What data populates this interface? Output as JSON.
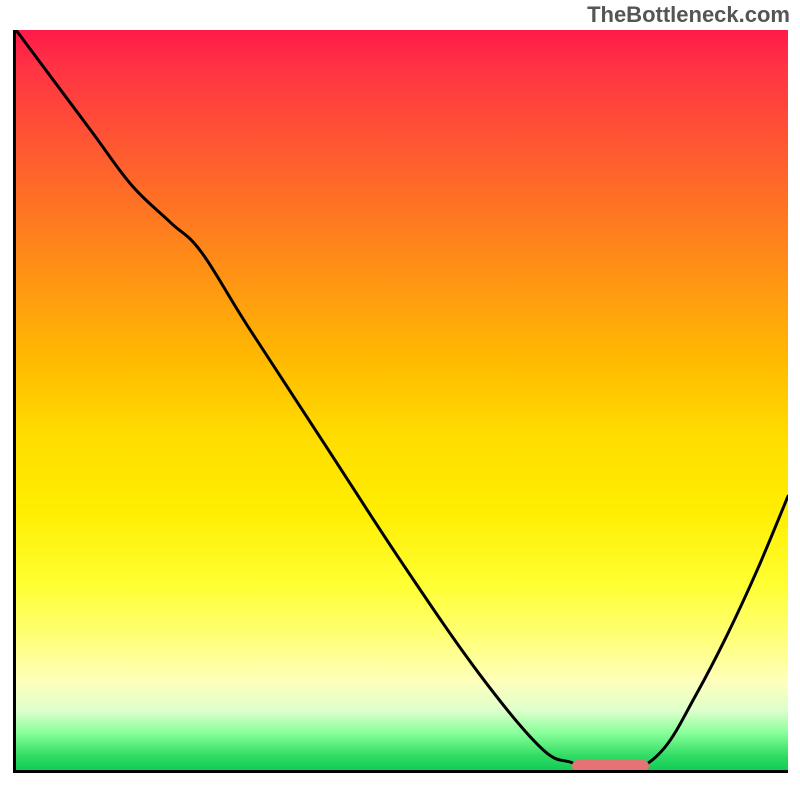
{
  "watermark": "TheBottleneck.com",
  "chart_data": {
    "type": "line",
    "title": "",
    "xlabel": "",
    "ylabel": "",
    "xlim": [
      0,
      100
    ],
    "ylim": [
      0,
      100
    ],
    "grid": false,
    "series": [
      {
        "name": "curve",
        "x": [
          0,
          5,
          10,
          15,
          20,
          24,
          30,
          40,
          50,
          60,
          68,
          72,
          76,
          80,
          84,
          88,
          92,
          96,
          100
        ],
        "y": [
          100,
          93,
          86,
          79,
          74,
          70,
          60,
          44,
          28,
          13,
          3,
          1,
          0,
          0,
          3,
          10,
          18,
          27,
          37
        ]
      }
    ],
    "marker": {
      "x_start": 72,
      "x_end": 82,
      "y": 0,
      "color": "#e57373"
    },
    "background_gradient": {
      "top": "#ff1a4a",
      "bottom": "#11cc55"
    }
  }
}
